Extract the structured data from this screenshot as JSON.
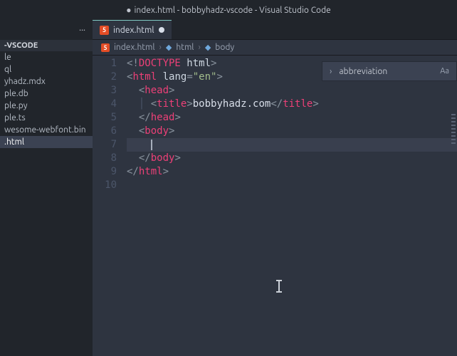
{
  "window": {
    "title": "index.html - bobbyhadz-vscode - Visual Studio Code",
    "modified_marker": "●"
  },
  "sidebar": {
    "ellipsis": "···",
    "header": "-VSCODE",
    "items": [
      {
        "label": "le"
      },
      {
        "label": "ql"
      },
      {
        "label": "yhadz.mdx"
      },
      {
        "label": "ple.db"
      },
      {
        "label": "ple.py"
      },
      {
        "label": "ple.ts"
      },
      {
        "label": "wesome-webfont.bin"
      },
      {
        "label": ".html",
        "selected": true
      }
    ]
  },
  "tab": {
    "label": "index.html",
    "icon": "5"
  },
  "breadcrumbs": {
    "segments": [
      "index.html",
      "html",
      "body"
    ],
    "icon": "5"
  },
  "editor": {
    "line_numbers": [
      "1",
      "2",
      "3",
      "4",
      "5",
      "6",
      "7",
      "8",
      "9",
      "10"
    ],
    "doc": {
      "doctype_open": "<!",
      "doctype_kw": "DOCTYPE",
      "doctype_val": " html",
      "doctype_close": ">",
      "lt": "<",
      "gt": ">",
      "lt_close": "</",
      "html": "html",
      "head": "head",
      "title": "title",
      "body": "body",
      "lang_attr": " lang",
      "eq": "=",
      "lang_val": "\"en\"",
      "title_text": "bobbyhadz.com"
    },
    "highlighted_line_index": 6
  },
  "search": {
    "text": "abbreviation",
    "chevron": "›",
    "aa": "Aa"
  }
}
